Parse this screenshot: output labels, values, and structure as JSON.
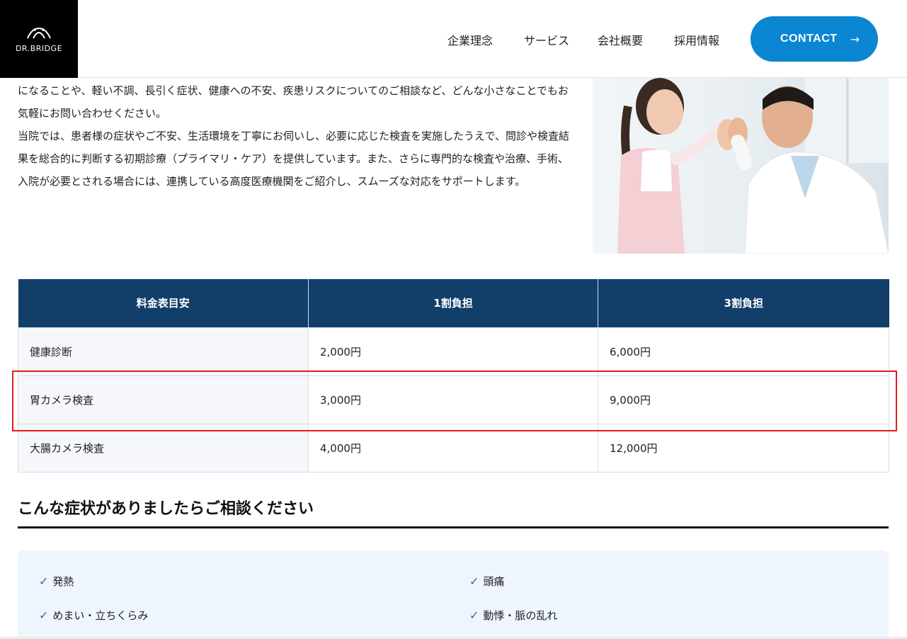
{
  "header": {
    "logo_text": "DR.BRIDGE",
    "nav": [
      "企業理念",
      "サービス",
      "会社概要",
      "採用情報"
    ],
    "contact_label": "CONTACT",
    "contact_arrow": "→"
  },
  "intro": {
    "paragraphs": [
      "になることや、軽い不調、長引く症状、健康への不安、疾患リスクについてのご相談など、どんな小さなことでもお気軽にお問い合わせください。",
      "当院では、患者様の症状やご不安、生活環境を丁寧にお伺いし、必要に応じた検査を実施したうえで、問診や検査結果を総合的に判断する初期診療（プライマリ・ケア）を提供しています。また、さらに専門的な検査や治療、手術、入院が必要とされる場合には、連携している高度医療機関をご紹介し、スムーズな対応をサポートします。"
    ]
  },
  "price_table": {
    "headers": [
      "料金表目安",
      "1割負担",
      "3割負担"
    ],
    "rows": [
      [
        "健康診断",
        "2,000円",
        "6,000円"
      ],
      [
        "胃カメラ検査",
        "3,000円",
        "9,000円"
      ],
      [
        "大腸カメラ検査",
        "4,000円",
        "12,000円"
      ]
    ]
  },
  "symptoms": {
    "title": "こんな症状がありましたらご相談ください",
    "items": [
      "発熱",
      "頭痛",
      "めまい・立ちくらみ",
      "動悸・脈の乱れ"
    ]
  },
  "colors": {
    "accent": "#0b86d3",
    "table_header": "#123e6a",
    "highlight": "#e31b1b",
    "check": "#1f6fb2"
  },
  "icons": {
    "logo": "bridge-arch-icon",
    "contact": "arrow-right-icon",
    "symptom": "check-icon"
  }
}
